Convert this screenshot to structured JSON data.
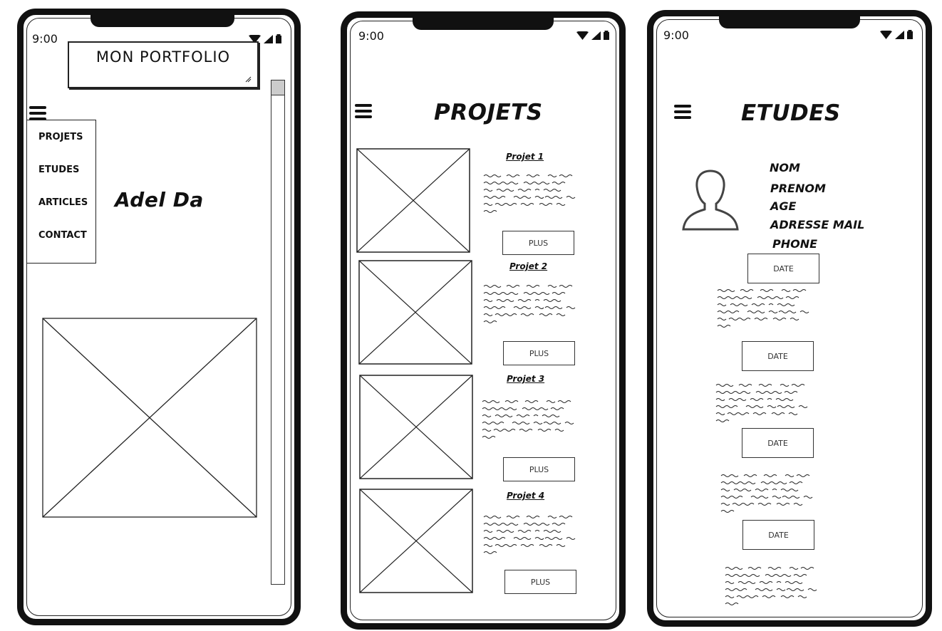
{
  "status_bar": {
    "time": "9:00"
  },
  "phone1": {
    "header_title": "MON PORTFOLIO",
    "menu": [
      "PROJETS",
      "ETUDES",
      "ARTICLES",
      "CONTACT"
    ],
    "name": "Adel Da"
  },
  "phone2": {
    "title": "PROJETS",
    "projects": [
      {
        "label": "Projet 1",
        "button": "PLUS"
      },
      {
        "label": "Projet 2",
        "button": "PLUS"
      },
      {
        "label": "Projet 3",
        "button": "PLUS"
      },
      {
        "label": "Projet 4",
        "button": "PLUS"
      }
    ]
  },
  "phone3": {
    "title": "ETUDES",
    "fields": [
      "NOM",
      "PRENOM",
      "AGE",
      "ADRESSE MAIL",
      "PHONE"
    ],
    "dates": [
      "DATE",
      "DATE",
      "DATE",
      "DATE"
    ]
  },
  "icons": {
    "menu": "hamburger-icon",
    "wifi": "wifi-icon",
    "signal": "signal-icon",
    "battery": "battery-icon",
    "image_placeholder": "image-placeholder-icon",
    "user": "user-avatar-icon",
    "resize": "resize-handle-icon"
  }
}
